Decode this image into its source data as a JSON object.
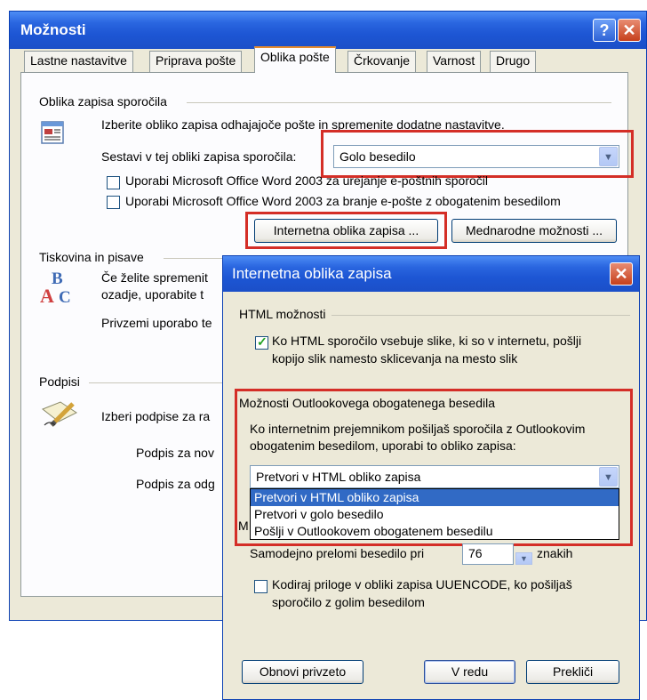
{
  "main": {
    "title": "Možnosti",
    "help_glyph": "?",
    "close_glyph": "✕",
    "tabs": [
      "Lastne nastavitve",
      "Priprava pošte",
      "Oblika pošte",
      "Črkovanje",
      "Varnost",
      "Drugo"
    ],
    "active_tab": "Oblika pošte",
    "format_section": {
      "label": "Oblika zapisa sporočila",
      "description": "Izberite obliko zapisa odhajajoče pošte in spremenite dodatne nastavitve.",
      "compose_label": "Sestavi v tej obliki zapisa sporočila:",
      "compose_value": "Golo besedilo",
      "checkbox1": "Uporabi Microsoft Office Word 2003 za urejanje e-poštnih sporočil",
      "checkbox2": "Uporabi Microsoft Office Word 2003 za branje e-pošte z obogatenim besedilom",
      "internet_button": "Internetna oblika zapisa ...",
      "international_button": "Mednarodne možnosti ..."
    },
    "stationery_section": {
      "label": "Tiskovina in pisave",
      "line1": "Če želite spremenit",
      "line2": "ozadje, uporabite t",
      "line3": "Privzemi uporabo te"
    },
    "signatures_section": {
      "label": "Podpisi",
      "line1": "Izberi podpise za ra",
      "line2": "Podpis za nov",
      "line3": "Podpis za odg"
    }
  },
  "dialog": {
    "title": "Internetna oblika zapisa",
    "close_glyph": "✕",
    "html_section_label": "HTML možnosti",
    "html_checkbox_line1": "Ko HTML sporočilo vsebuje slike, ki so v internetu, pošlji",
    "html_checkbox_line2": "kopijo slik namesto sklicevanja na mesto slik",
    "rich_section_label": "Možnosti Outlookovega obogatenega besedila",
    "rich_desc_line1": "Ko internetnim prejemnikom pošiljaš sporočila z Outlookovim",
    "rich_desc_line2": "obogatenim besedilom, uporabi to obliko zapisa:",
    "rich_select_value": "Pretvori v HTML obliko zapisa",
    "rich_options": [
      "Pretvori v HTML obliko zapisa",
      "Pretvori v golo besedilo",
      "Pošlji v Outlookovem obogatenem besedilu"
    ],
    "plain_section_label_partial": "M",
    "wrap_label": "Samodejno prelomi besedilo pri",
    "wrap_value": "76",
    "wrap_unit": "znakih",
    "uuencode_line1": "Kodiraj priloge v obliki zapisa UUENCODE, ko pošiljaš",
    "uuencode_line2": "sporočilo z golim besedilom",
    "restore_button": "Obnovi privzeto",
    "ok_button": "V redu",
    "cancel_button": "Prekliči"
  },
  "colors": {
    "titlebar": "#2a66e0",
    "highlight_box": "#d42e27",
    "selection": "#316ac5",
    "dialog_bg": "#ece9d8"
  },
  "icons": [
    "message-format-icon",
    "stationery-abc-icon",
    "signature-pen-icon",
    "chevron-down-icon",
    "spinner-down-icon"
  ]
}
